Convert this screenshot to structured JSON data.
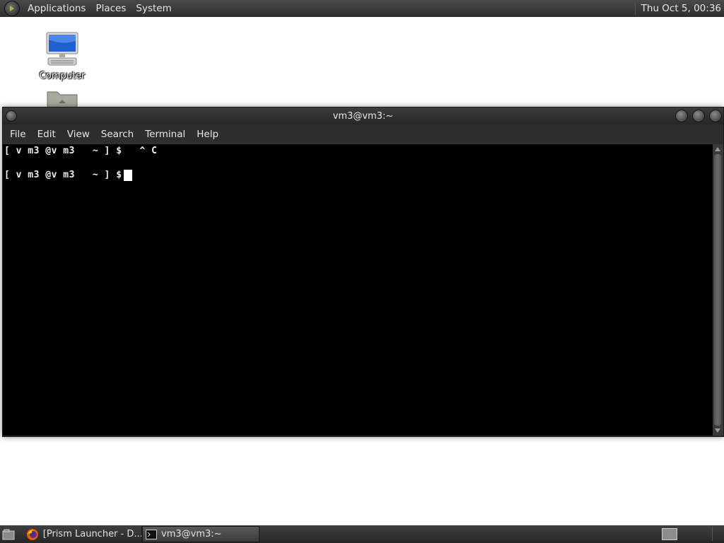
{
  "top_panel": {
    "menu": [
      "Applications",
      "Places",
      "System"
    ],
    "clock": "Thu Oct  5, 00:36",
    "logo_icon": "distro-logo-icon"
  },
  "desktop": {
    "icons": [
      {
        "label": "Computer",
        "icon": "computer-icon"
      },
      {
        "label": "",
        "icon": "home-folder-icon"
      }
    ]
  },
  "terminal": {
    "title": "vm3@vm3:~",
    "menu": [
      "File",
      "Edit",
      "View",
      "Search",
      "Terminal",
      "Help"
    ],
    "lines": [
      "[ v m3 @v m3   ~ ] $   ^ C",
      "[ v m3 @v m3   ~ ] $"
    ]
  },
  "taskbar": {
    "show_desktop_icon": "show-desktop-icon",
    "tasks": [
      {
        "label": "[Prism Launcher - D...",
        "icon": "firefox-icon",
        "active": false
      },
      {
        "label": "vm3@vm3:~",
        "icon": "terminal-icon",
        "active": true
      }
    ]
  },
  "colors": {
    "panel": "#2e2e2e",
    "terminal_bg": "#000000",
    "terminal_fg": "#f0f0f0",
    "desktop_bg": "#ffffff"
  }
}
